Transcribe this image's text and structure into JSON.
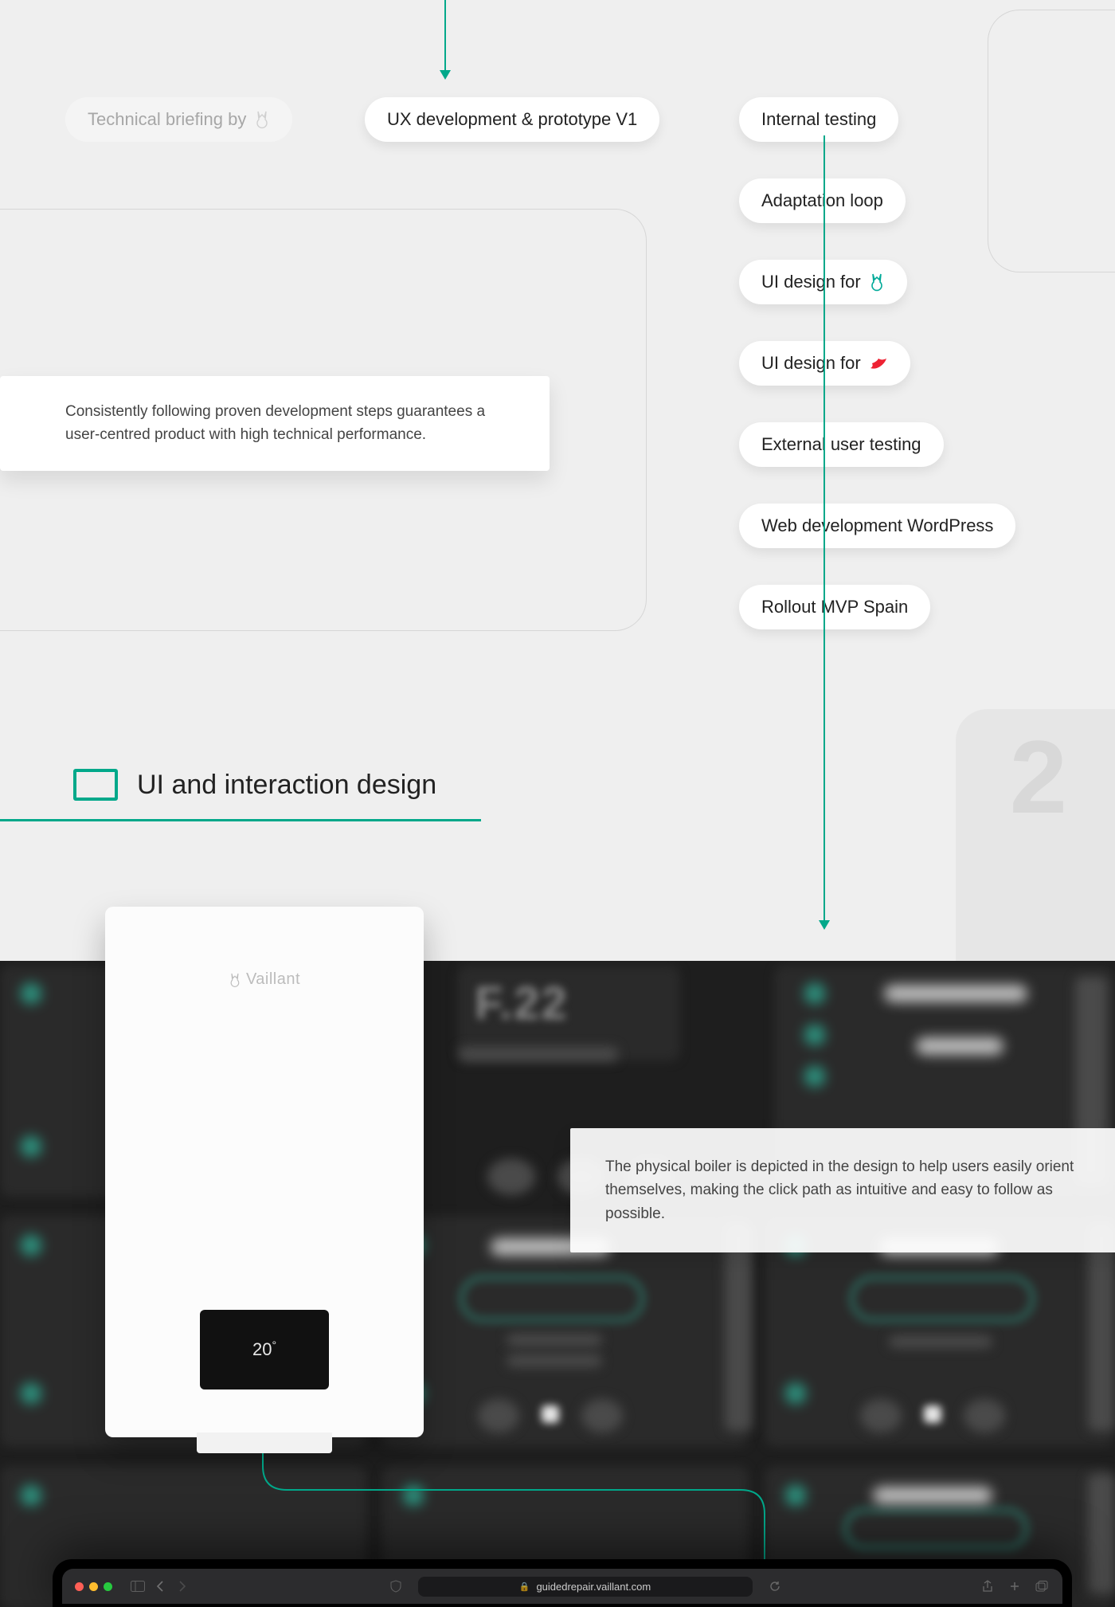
{
  "process": {
    "step_faded": "Technical briefing by",
    "step_ux": "UX development & prototype V1",
    "steps_right": [
      "Internal testing",
      "Adaptation loop",
      "UI design for",
      "UI design for",
      "External user testing",
      "Web development WordPress",
      "Rollout MVP Spain"
    ]
  },
  "callouts": {
    "c1": "Consistently following proven development steps guarantees a user-centred product with high technical performance.",
    "c2": "The physical boiler is depicted in the design to help users easily orient themselves, making the click path as intuitive and easy to follow as possible."
  },
  "section2": {
    "number": "2",
    "title": "UI and interaction design"
  },
  "boiler": {
    "brand": "Vaillant",
    "display_temp": "20",
    "display_unit": "°"
  },
  "dark_tiles": {
    "fault_code": "F.22"
  },
  "browser": {
    "url": "guidedrepair.vaillant.com"
  }
}
